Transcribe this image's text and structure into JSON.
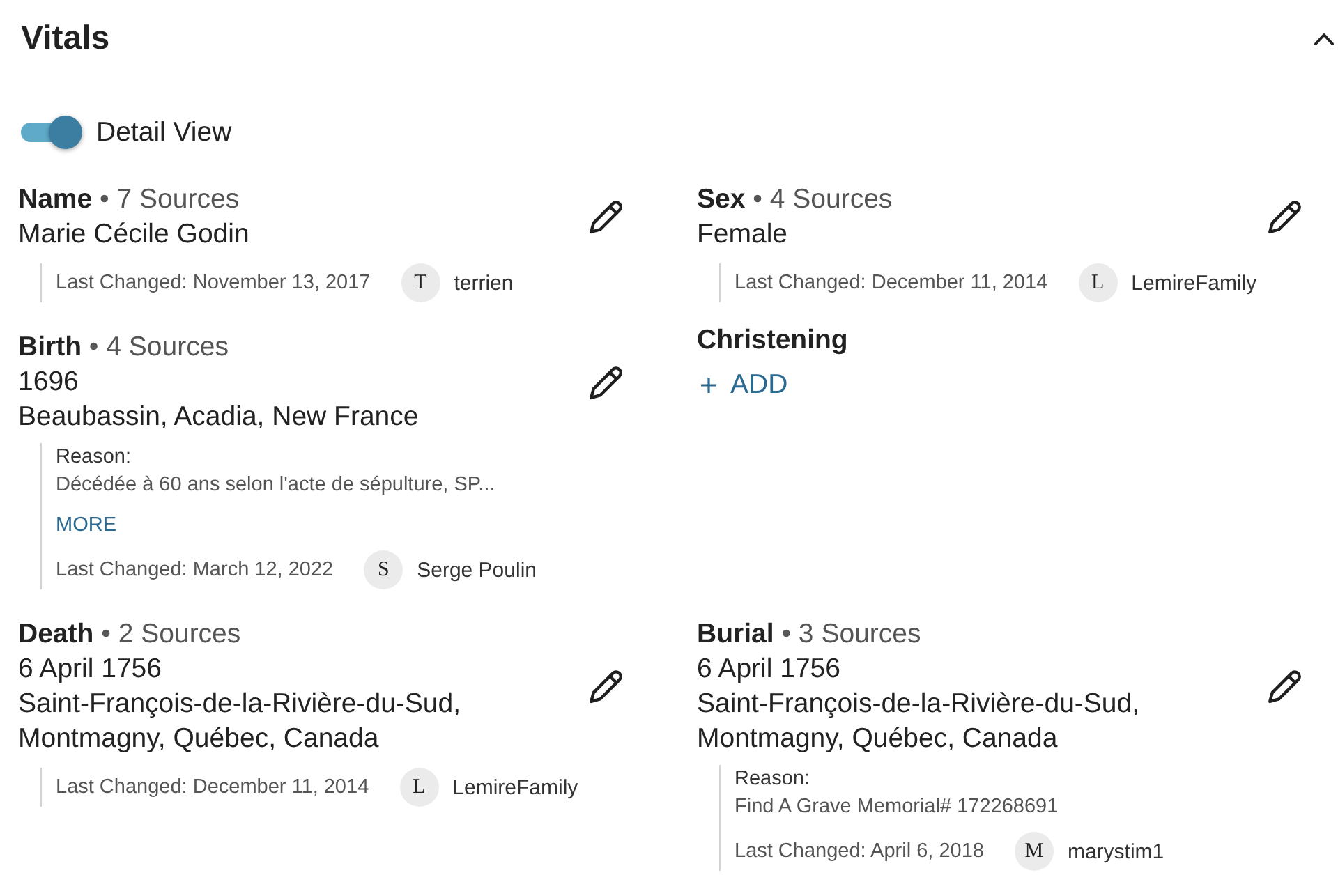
{
  "section": {
    "title": "Vitals",
    "expanded": true
  },
  "detail_view": {
    "label": "Detail View",
    "on": true
  },
  "facts": [
    {
      "kind": "fact",
      "label": "Name",
      "sources": "• 7 Sources",
      "values": [
        "Marie Cécile Godin"
      ],
      "changed": {
        "text": "Last Changed: November 13, 2017",
        "initial": "T",
        "user": "terrien"
      }
    },
    {
      "kind": "fact",
      "label": "Sex",
      "sources": "• 4 Sources",
      "values": [
        "Female"
      ],
      "changed": {
        "text": "Last Changed: December 11, 2014",
        "initial": "L",
        "user": "LemireFamily"
      }
    },
    {
      "kind": "fact",
      "label": "Birth",
      "sources": "• 4 Sources",
      "values": [
        "1696",
        "Beaubassin, Acadia, New France"
      ],
      "reason": {
        "label": "Reason:",
        "text": "Décédée à 60 ans selon l'acte de sépulture, SP...",
        "more": "MORE"
      },
      "changed": {
        "text": "Last Changed: March 12, 2022",
        "initial": "S",
        "user": "Serge Poulin"
      }
    },
    {
      "kind": "empty",
      "label": "Christening",
      "add": "ADD"
    },
    {
      "kind": "fact",
      "label": "Death",
      "sources": "• 2 Sources",
      "values": [
        "6 April 1756",
        "Saint-François-de-la-Rivière-du-Sud, Montmagny, Québec, Canada"
      ],
      "changed": {
        "text": "Last Changed: December 11, 2014",
        "initial": "L",
        "user": "LemireFamily"
      }
    },
    {
      "kind": "fact",
      "label": "Burial",
      "sources": "• 3 Sources",
      "values": [
        "6 April 1756",
        "Saint-François-de-la-Rivière-du-Sud, Montmagny, Québec, Canada"
      ],
      "reason": {
        "label": "Reason:",
        "text": "Find A Grave Memorial# 172268691"
      },
      "changed": {
        "text": "Last Changed: April 6, 2018",
        "initial": "M",
        "user": "marystim1"
      }
    }
  ]
}
